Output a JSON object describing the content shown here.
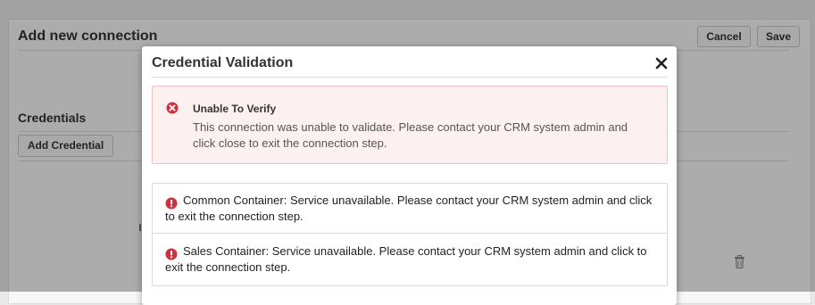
{
  "background": {
    "title": "Add new connection",
    "cancel_label": "Cancel",
    "save_label": "Save",
    "credentials_heading": "Credentials",
    "add_credential_label": "Add Credential"
  },
  "modal": {
    "title": "Credential Validation",
    "close_icon": "close-icon",
    "alert": {
      "icon": "error-circle-icon",
      "title": "Unable To Verify",
      "message": "This connection was unable to validate. Please contact your CRM system admin and click close to exit the connection step."
    },
    "errors": [
      {
        "icon": "error-icon",
        "text": "Common Container: Service unavailable. Please contact your CRM system admin and click to exit the connection step."
      },
      {
        "icon": "error-icon",
        "text": "Sales Container: Service unavailable. Please contact your CRM system admin and click to exit the connection step."
      }
    ]
  },
  "colors": {
    "error_red": "#cc3340",
    "alert_bg": "#fdf0f0",
    "alert_border": "#f0c3c3"
  }
}
